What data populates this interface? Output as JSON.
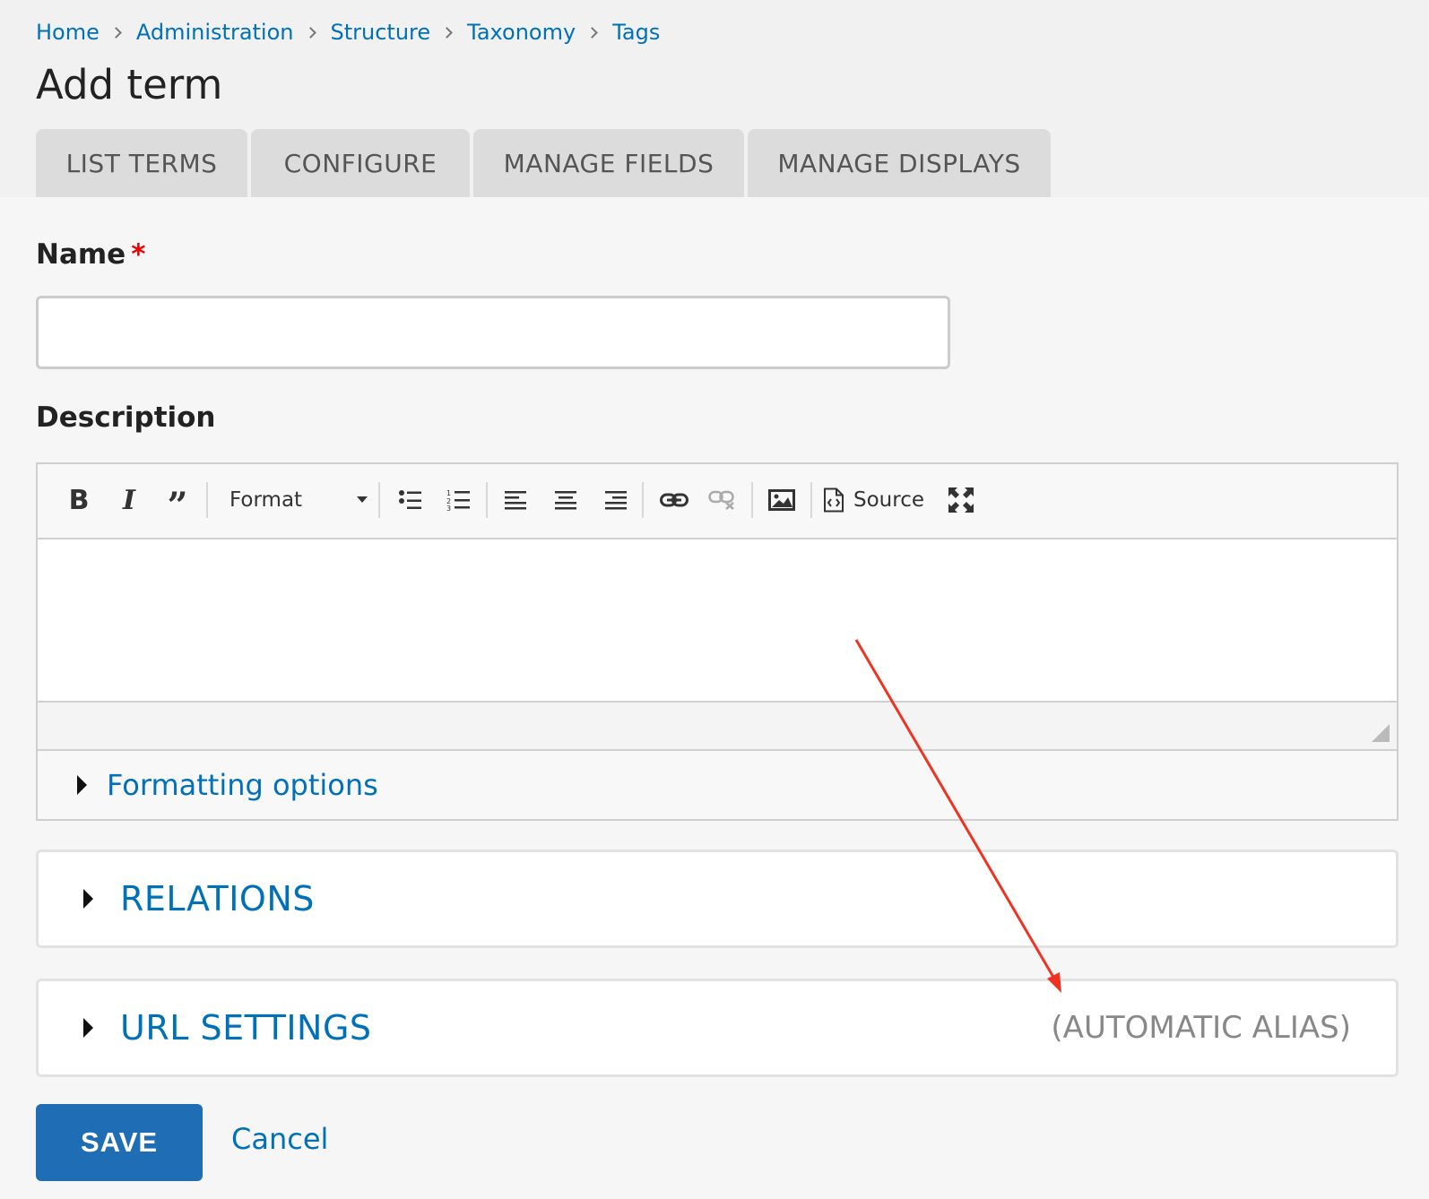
{
  "breadcrumb": {
    "items": [
      "Home",
      "Administration",
      "Structure",
      "Taxonomy",
      "Tags"
    ]
  },
  "page": {
    "title": "Add term"
  },
  "tabs": [
    {
      "label": "LIST TERMS"
    },
    {
      "label": "CONFIGURE"
    },
    {
      "label": "MANAGE FIELDS"
    },
    {
      "label": "MANAGE DISPLAYS"
    }
  ],
  "form": {
    "name": {
      "label": "Name",
      "required_marker": "*",
      "value": ""
    },
    "description": {
      "label": "Description",
      "toolbar": {
        "format_label": "Format",
        "source_label": "Source"
      },
      "formatting_options_label": "Formatting options"
    },
    "relations": {
      "title": "RELATIONS"
    },
    "url_settings": {
      "title": "URL SETTINGS",
      "summary": "(AUTOMATIC ALIAS)"
    },
    "actions": {
      "save_label": "SAVE",
      "cancel_label": "Cancel"
    }
  },
  "colors": {
    "link": "#0071b8",
    "primary_button": "#1f6eb5",
    "required": "#ee0000",
    "annotation_arrow": "#ee3322"
  },
  "icons": [
    "bold-icon",
    "italic-icon",
    "blockquote-icon",
    "dropdown-caret-icon",
    "bullet-list-icon",
    "numbered-list-icon",
    "align-left-icon",
    "align-center-icon",
    "align-right-icon",
    "link-icon",
    "unlink-icon",
    "image-icon",
    "source-icon",
    "maximize-icon",
    "resize-grip-icon",
    "disclosure-triangle-icon"
  ]
}
